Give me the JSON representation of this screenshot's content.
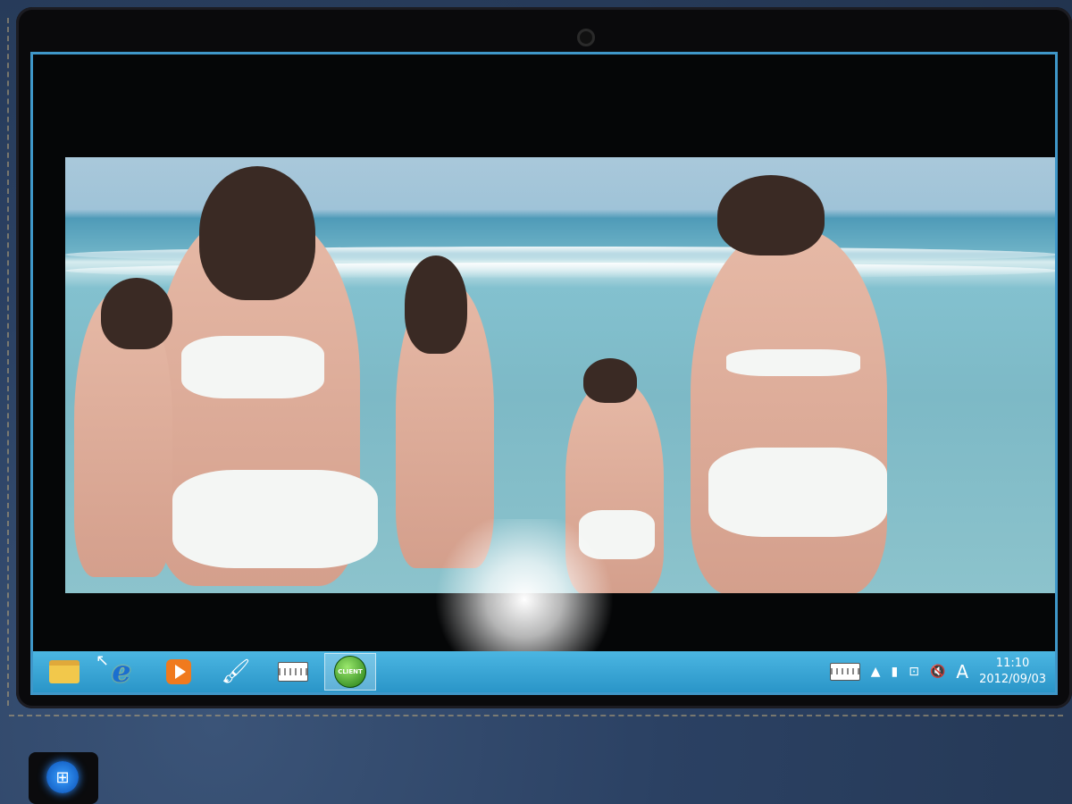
{
  "taskbar": {
    "apps": [
      {
        "name": "file-explorer"
      },
      {
        "name": "internet-explorer",
        "glyph": "e"
      },
      {
        "name": "media-player"
      },
      {
        "name": "paint"
      },
      {
        "name": "on-screen-keyboard"
      },
      {
        "name": "app-active",
        "badge": "CLIENT"
      }
    ],
    "tray": {
      "language": "A",
      "time": "11:10",
      "date": "2012/09/03"
    }
  },
  "colors": {
    "taskbar": "#2a95c8",
    "screen_border": "#3f97c9"
  }
}
